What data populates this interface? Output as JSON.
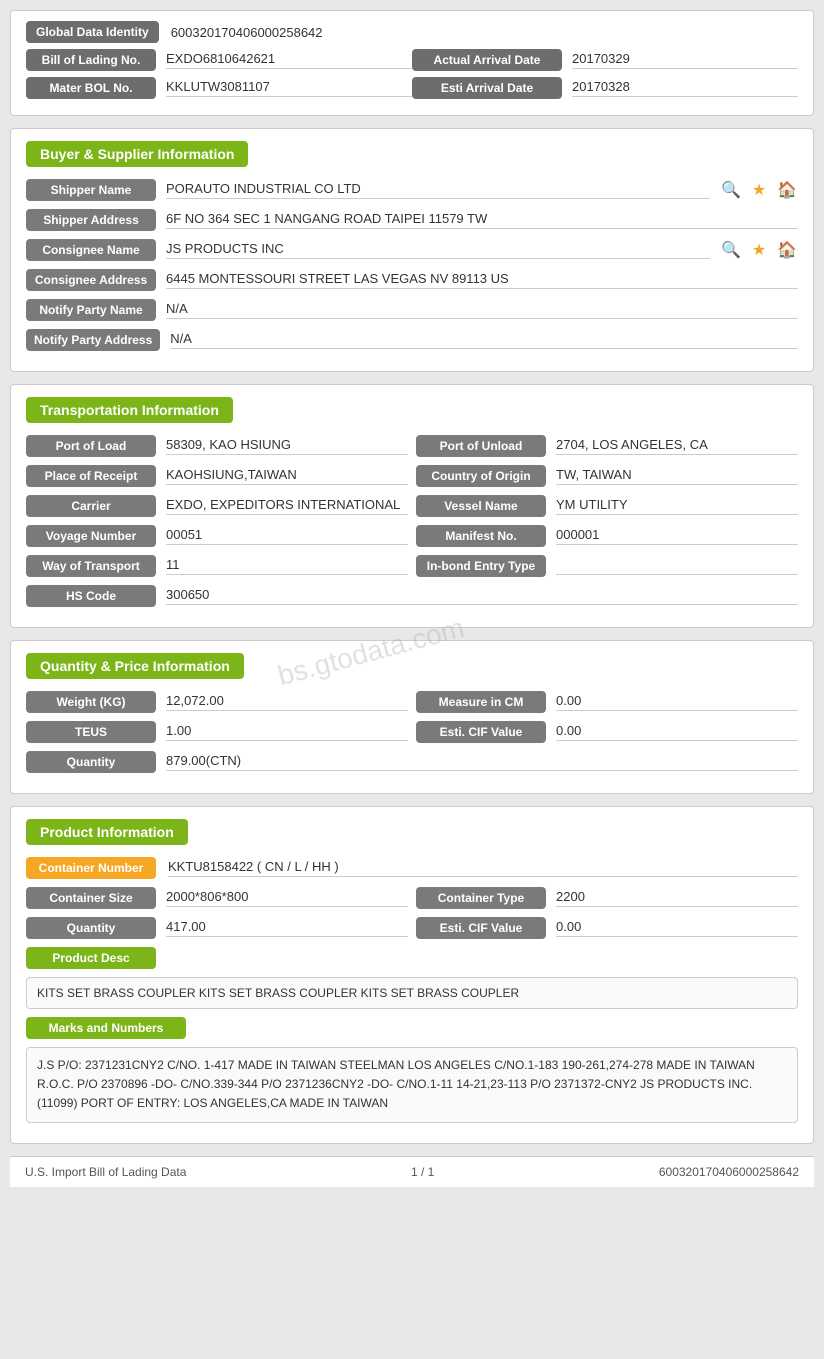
{
  "global": {
    "identity_label": "Global Data Identity",
    "identity_value": "600320170406000258642",
    "bol_label": "Bill of Lading No.",
    "bol_value": "EXDO6810642621",
    "actual_arrival_label": "Actual Arrival Date",
    "actual_arrival_value": "20170329",
    "master_bol_label": "Mater BOL No.",
    "master_bol_value": "KKLUTW3081107",
    "esti_arrival_label": "Esti Arrival Date",
    "esti_arrival_value": "20170328"
  },
  "buyer_supplier": {
    "header": "Buyer & Supplier Information",
    "shipper_name_label": "Shipper Name",
    "shipper_name_value": "PORAUTO INDUSTRIAL CO LTD",
    "shipper_address_label": "Shipper Address",
    "shipper_address_value": "6F NO 364 SEC 1 NANGANG ROAD TAIPEI 11579 TW",
    "consignee_name_label": "Consignee Name",
    "consignee_name_value": "JS PRODUCTS INC",
    "consignee_address_label": "Consignee Address",
    "consignee_address_value": "6445 MONTESSOURI STREET LAS VEGAS NV 89113 US",
    "notify_party_name_label": "Notify Party Name",
    "notify_party_name_value": "N/A",
    "notify_party_address_label": "Notify Party Address",
    "notify_party_address_value": "N/A"
  },
  "transportation": {
    "header": "Transportation Information",
    "port_of_load_label": "Port of Load",
    "port_of_load_value": "58309, KAO HSIUNG",
    "port_of_unload_label": "Port of Unload",
    "port_of_unload_value": "2704, LOS ANGELES, CA",
    "place_of_receipt_label": "Place of Receipt",
    "place_of_receipt_value": "KAOHSIUNG,TAIWAN",
    "country_of_origin_label": "Country of Origin",
    "country_of_origin_value": "TW, TAIWAN",
    "carrier_label": "Carrier",
    "carrier_value": "EXDO, EXPEDITORS INTERNATIONAL",
    "vessel_name_label": "Vessel Name",
    "vessel_name_value": "YM UTILITY",
    "voyage_number_label": "Voyage Number",
    "voyage_number_value": "00051",
    "manifest_no_label": "Manifest No.",
    "manifest_no_value": "000001",
    "way_of_transport_label": "Way of Transport",
    "way_of_transport_value": "11",
    "in_bond_entry_label": "In-bond Entry Type",
    "in_bond_entry_value": "",
    "hs_code_label": "HS Code",
    "hs_code_value": "300650"
  },
  "quantity_price": {
    "header": "Quantity & Price Information",
    "weight_label": "Weight (KG)",
    "weight_value": "12,072.00",
    "measure_label": "Measure in CM",
    "measure_value": "0.00",
    "teus_label": "TEUS",
    "teus_value": "1.00",
    "esti_cif_label": "Esti. CIF Value",
    "esti_cif_value": "0.00",
    "quantity_label": "Quantity",
    "quantity_value": "879.00(CTN)"
  },
  "product": {
    "header": "Product Information",
    "container_number_label": "Container Number",
    "container_number_value": "KKTU8158422 ( CN / L / HH )",
    "container_size_label": "Container Size",
    "container_size_value": "2000*806*800",
    "container_type_label": "Container Type",
    "container_type_value": "2200",
    "quantity_label": "Quantity",
    "quantity_value": "417.00",
    "esti_cif_label": "Esti. CIF Value",
    "esti_cif_value": "0.00",
    "product_desc_label": "Product Desc",
    "product_desc_value": "KITS SET BRASS COUPLER KITS SET BRASS COUPLER KITS SET BRASS COUPLER",
    "marks_label": "Marks and Numbers",
    "marks_value": "J.S P/O: 2371231CNY2 C/NO. 1-417 MADE IN TAIWAN STEELMAN LOS ANGELES C/NO.1-183 190-261,274-278 MADE IN TAIWAN R.O.C. P/O 2370896 -DO- C/NO.339-344 P/O 2371236CNY2 -DO- C/NO.1-11 14-21,23-113 P/O 2371372-CNY2 JS PRODUCTS INC. (11099) PORT OF ENTRY: LOS ANGELES,CA MADE IN TAIWAN"
  },
  "footer": {
    "left": "U.S. Import Bill of Lading Data",
    "center": "1 / 1",
    "right": "600320170406000258642"
  },
  "watermark": "bs.gtodata.com"
}
